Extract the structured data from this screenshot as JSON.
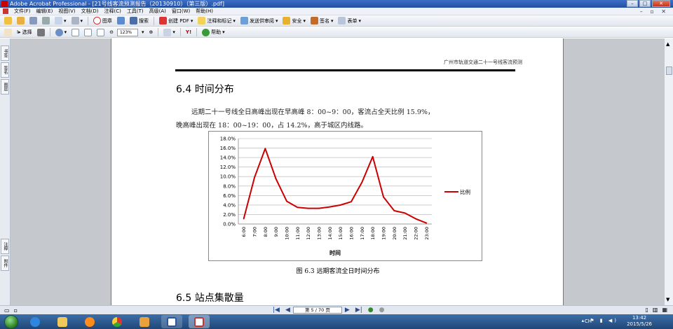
{
  "window": {
    "title": "Adobe Acrobat Professional - [21号线客流预测报告（20130910）（第三版）.pdf]"
  },
  "menu": [
    "文件(F)",
    "编辑(E)",
    "视图(V)",
    "文档(D)",
    "注释(C)",
    "工具(T)",
    "高级(A)",
    "窗口(W)",
    "帮助(H)"
  ],
  "toolbar1": {
    "graphic_label": "图章",
    "search_label": "搜索",
    "create_pdf_label": "创建 PDF",
    "comment_label": "注释和标记",
    "send_review_label": "发送供审阅",
    "secure_label": "安全",
    "sign_label": "签名",
    "forms_label": "表单"
  },
  "toolbar2": {
    "select_label": "选择",
    "zoom_value": "123%",
    "help_label": "帮助"
  },
  "left_tabs": [
    "书签",
    "签名",
    "图层"
  ],
  "left_tabs_bottom": [
    "注释",
    "附件"
  ],
  "document": {
    "running_header": "广州市轨道交通二十一号线客流预测",
    "section_title": "6.4  时间分布",
    "paragraph_line1": "远期二十一号线全日高峰出现在早高峰 8：00~9：00，客流占全天比例 15.9%，",
    "paragraph_line2": "晚高峰出现在 18：00~19：00，占 14.2%，高于城区内线路。",
    "figure_caption": "图 6.3  远期客流全日时间分布",
    "next_section_title": "6.5  站点集散量"
  },
  "chart_data": {
    "type": "line",
    "x": [
      "6:00",
      "7:00",
      "8:00",
      "9:00",
      "10:00",
      "11:00",
      "12:00",
      "13:00",
      "14:00",
      "15:00",
      "16:00",
      "17:00",
      "18:00",
      "19:00",
      "20:00",
      "21:00",
      "22:00",
      "23:00"
    ],
    "series": [
      {
        "name": "比例",
        "values": [
          1.1,
          9.8,
          15.9,
          9.5,
          4.8,
          3.5,
          3.3,
          3.3,
          3.6,
          4.0,
          4.7,
          8.8,
          14.2,
          5.7,
          2.8,
          2.3,
          1.1,
          0.2
        ],
        "color": "#cc0000"
      }
    ],
    "xlabel": "时间",
    "ylabel": "",
    "y_ticks": [
      "0.0%",
      "2.0%",
      "4.0%",
      "6.0%",
      "8.0%",
      "10.0%",
      "12.0%",
      "14.0%",
      "16.0%",
      "18.0%"
    ],
    "ylim": [
      0,
      18
    ],
    "grid": true,
    "legend": "right"
  },
  "navigation": {
    "page_indicator": "第 5 / 70 页"
  },
  "taskbar": {
    "clock_time": "13:42",
    "clock_date": "2015/5/26",
    "lang": "CH"
  }
}
